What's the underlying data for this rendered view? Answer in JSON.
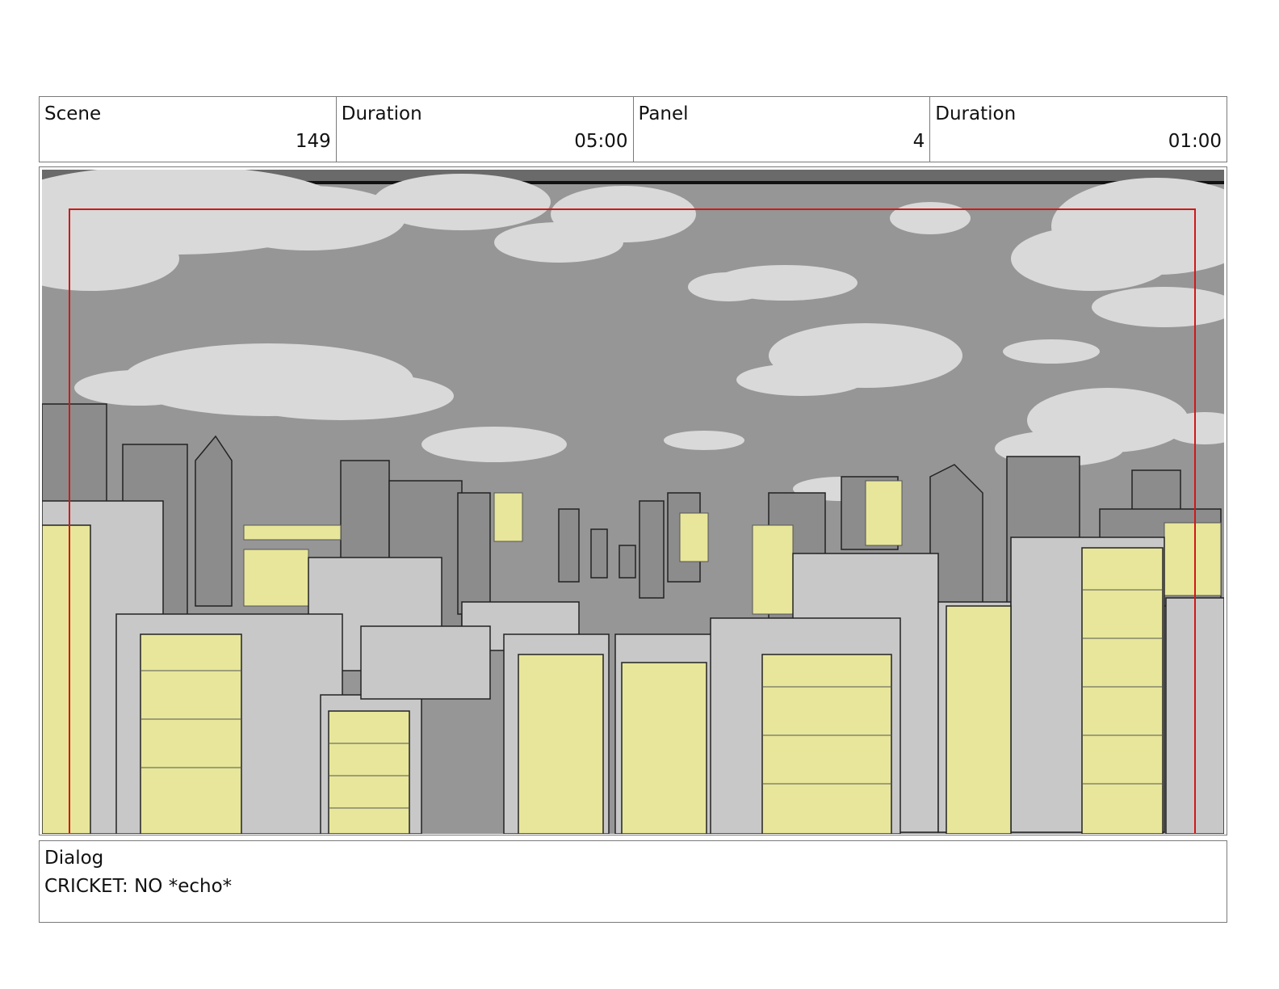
{
  "header": {
    "scene_label": "Scene",
    "scene_value": "149",
    "scene_duration_label": "Duration",
    "scene_duration_value": "05:00",
    "panel_label": "Panel",
    "panel_value": "4",
    "panel_duration_label": "Duration",
    "panel_duration_value": "01:00"
  },
  "panel_image": {
    "description_icon": "city-skyline-illustration",
    "colors": {
      "sky": "#969696",
      "cloud": "#d9d9d9",
      "building_light": "#c8c8c8",
      "building_dark": "#8a8a8a",
      "window_lit": "#e8e69a",
      "safe_frame": "#d01818"
    }
  },
  "dialog": {
    "label": "Dialog",
    "text": "CRICKET: NO *echo*"
  }
}
